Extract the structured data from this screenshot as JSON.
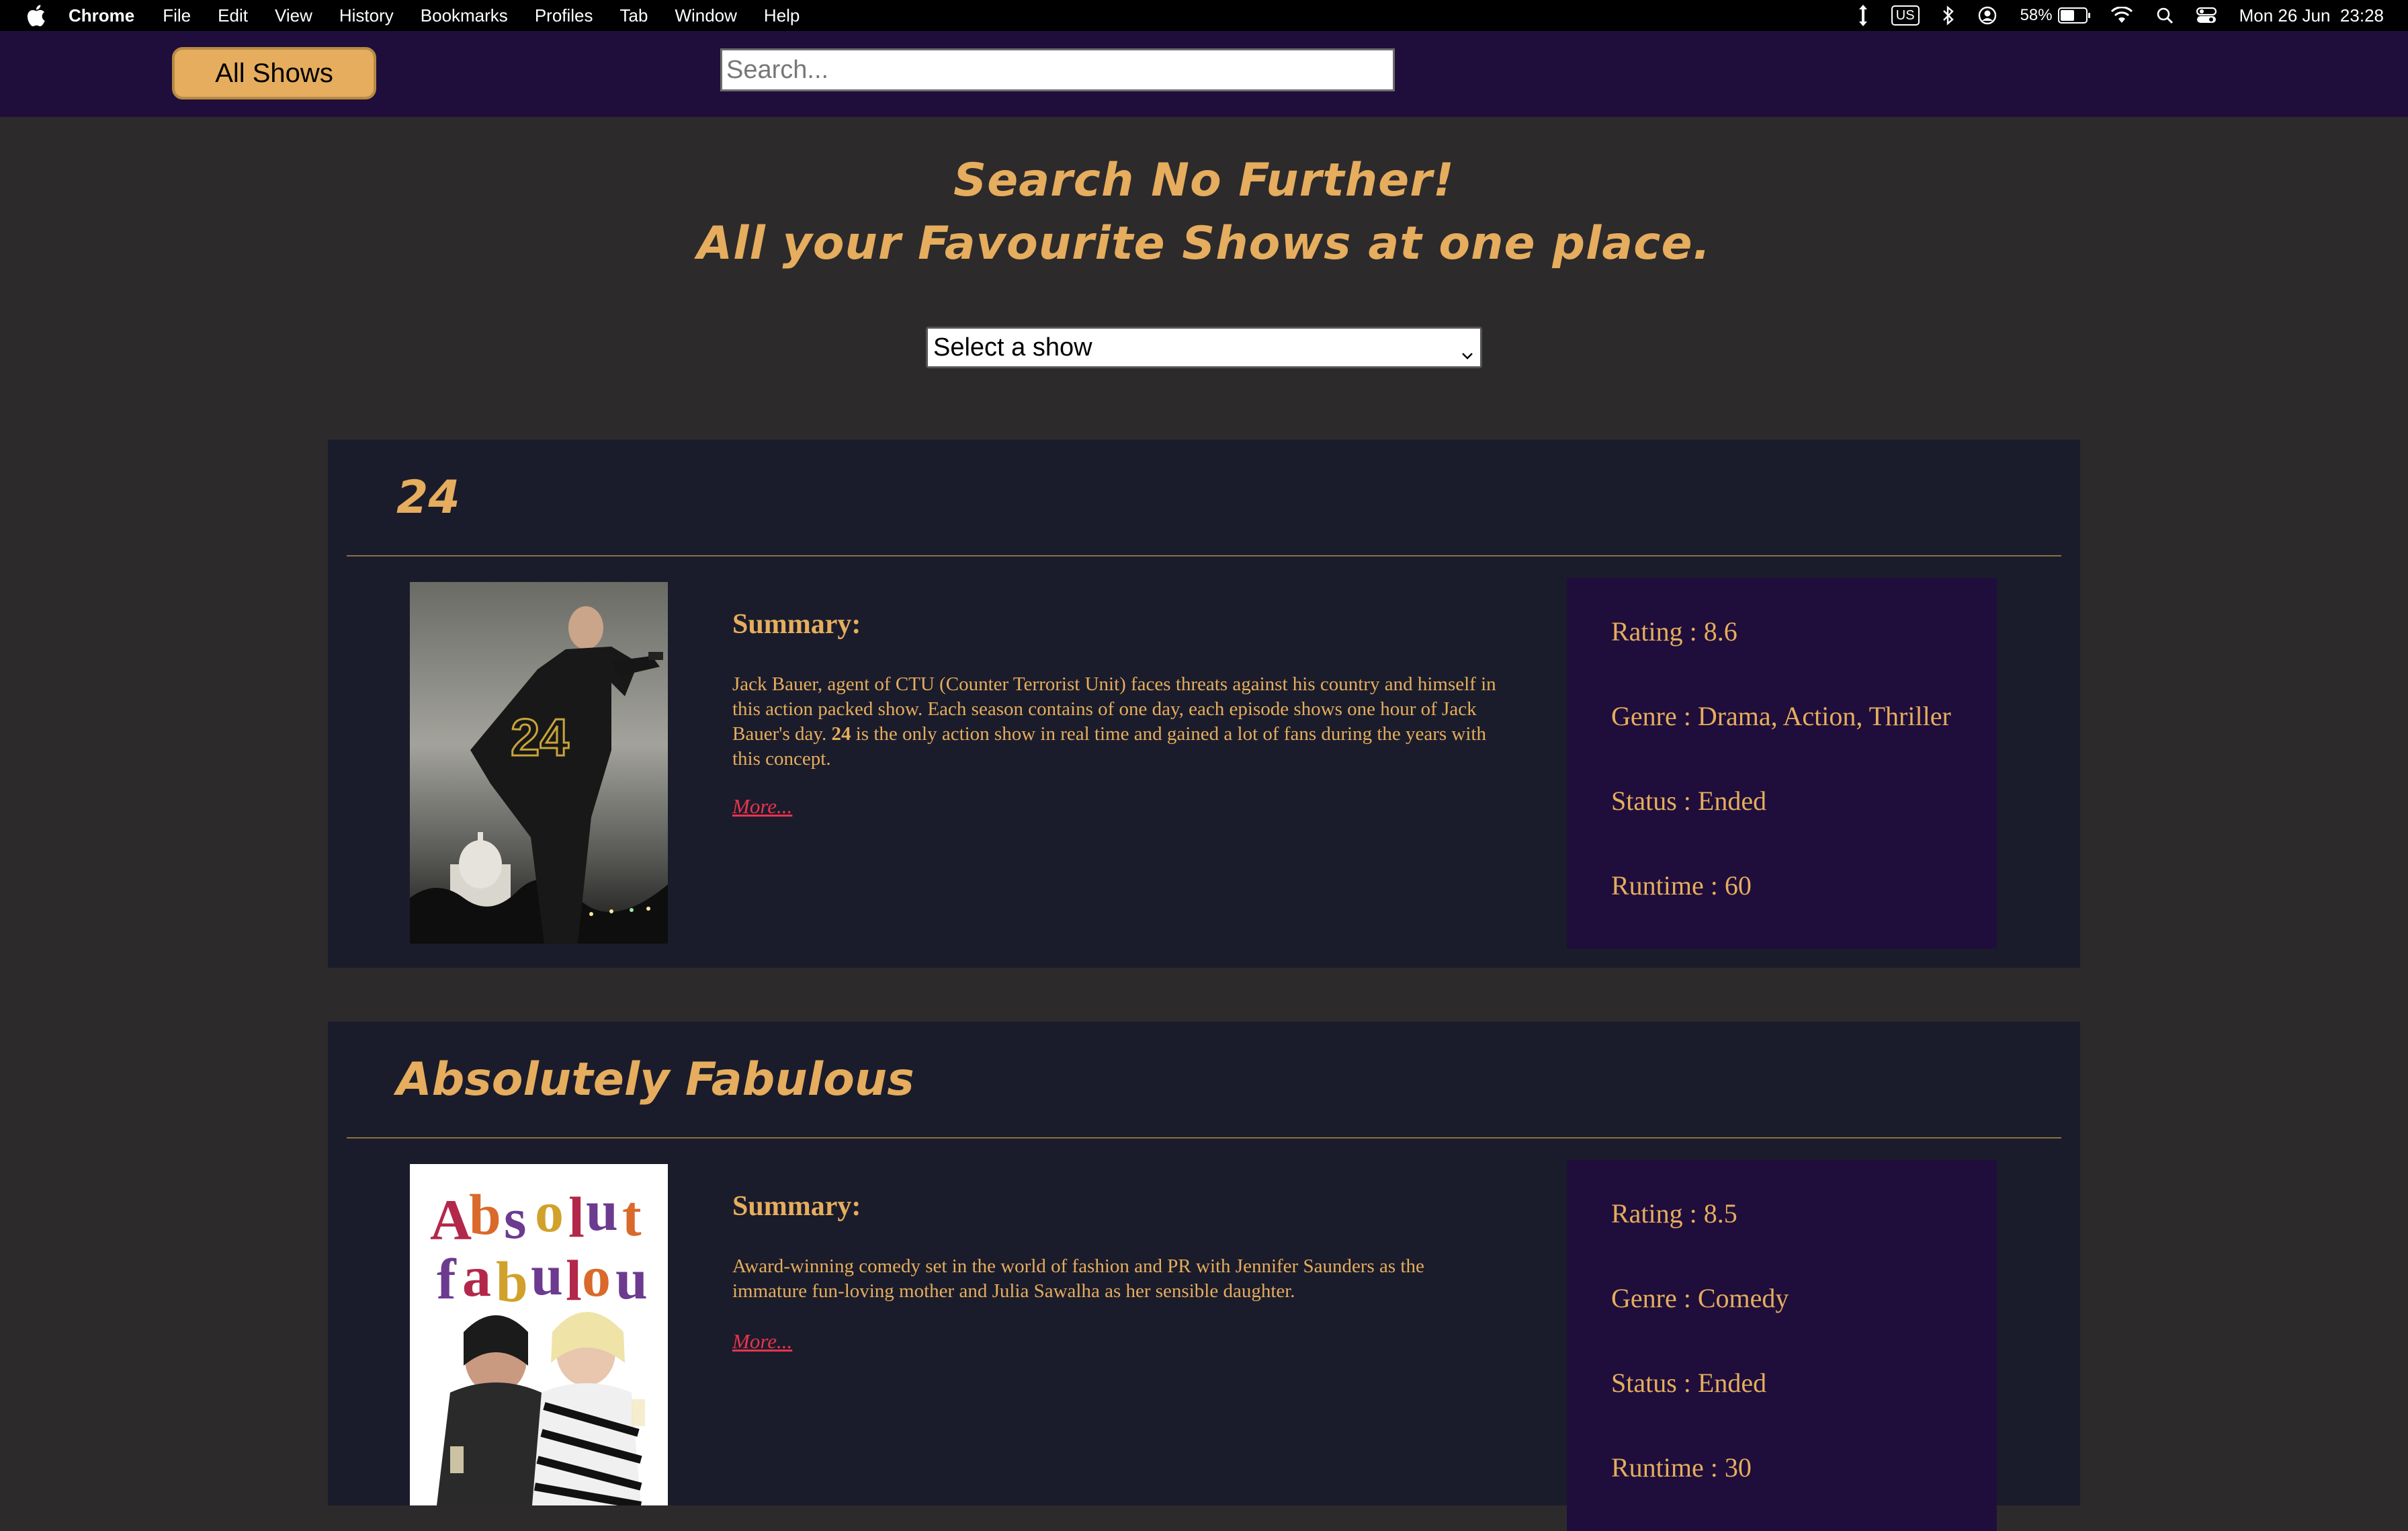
{
  "menubar": {
    "app_name": "Chrome",
    "items": [
      "File",
      "Edit",
      "View",
      "History",
      "Bookmarks",
      "Profiles",
      "Tab",
      "Window",
      "Help"
    ],
    "keyboard_layout": "US",
    "battery_percent": "58%",
    "datetime": "Mon 26 Jun  23:28"
  },
  "navbar": {
    "all_shows_label": "All Shows",
    "search_placeholder": "Search...",
    "search_value": ""
  },
  "hero": {
    "line1": "Search No Further!",
    "line2": "All your Favourite Shows at one place."
  },
  "select": {
    "selected": "Select a show"
  },
  "shows": [
    {
      "title": "24",
      "summary_heading": "Summary:",
      "summary_before": "Jack Bauer, agent of CTU (Counter Terrorist Unit) faces threats against his country and himself in this action packed show. Each season contains of one day, each episode shows one hour of Jack Bauer's day. ",
      "summary_bold": "24",
      "summary_after": " is the only action show in real time and gained a lot of fans during the years with this concept.",
      "more_label": "More...",
      "rating": "Rating : 8.6",
      "genre": "Genre : Drama, Action, Thriller",
      "status": "Status : Ended",
      "runtime": "Runtime : 60"
    },
    {
      "title": "Absolutely Fabulous",
      "summary_heading": "Summary:",
      "summary_text": "Award-winning comedy set in the world of fashion and PR with Jennifer Saunders as the immature fun-loving mother and Julia Sawalha as her sensible daughter.",
      "more_label": "More...",
      "rating": "Rating : 8.5",
      "genre": "Genre : Comedy",
      "status": "Status : Ended",
      "runtime": "Runtime : 30"
    }
  ],
  "colors": {
    "accent": "#e5ad5d",
    "nav_bg": "#1f0e3b",
    "page_bg": "#2d2a2c",
    "card_bg": "#1b1c2b",
    "link": "#e8344e"
  },
  "icons": [
    "apple-icon",
    "chevron-down-icon",
    "cursor-icon",
    "bluetooth-icon",
    "user-icon",
    "wifi-icon",
    "spotlight-icon",
    "control-center-icon"
  ]
}
